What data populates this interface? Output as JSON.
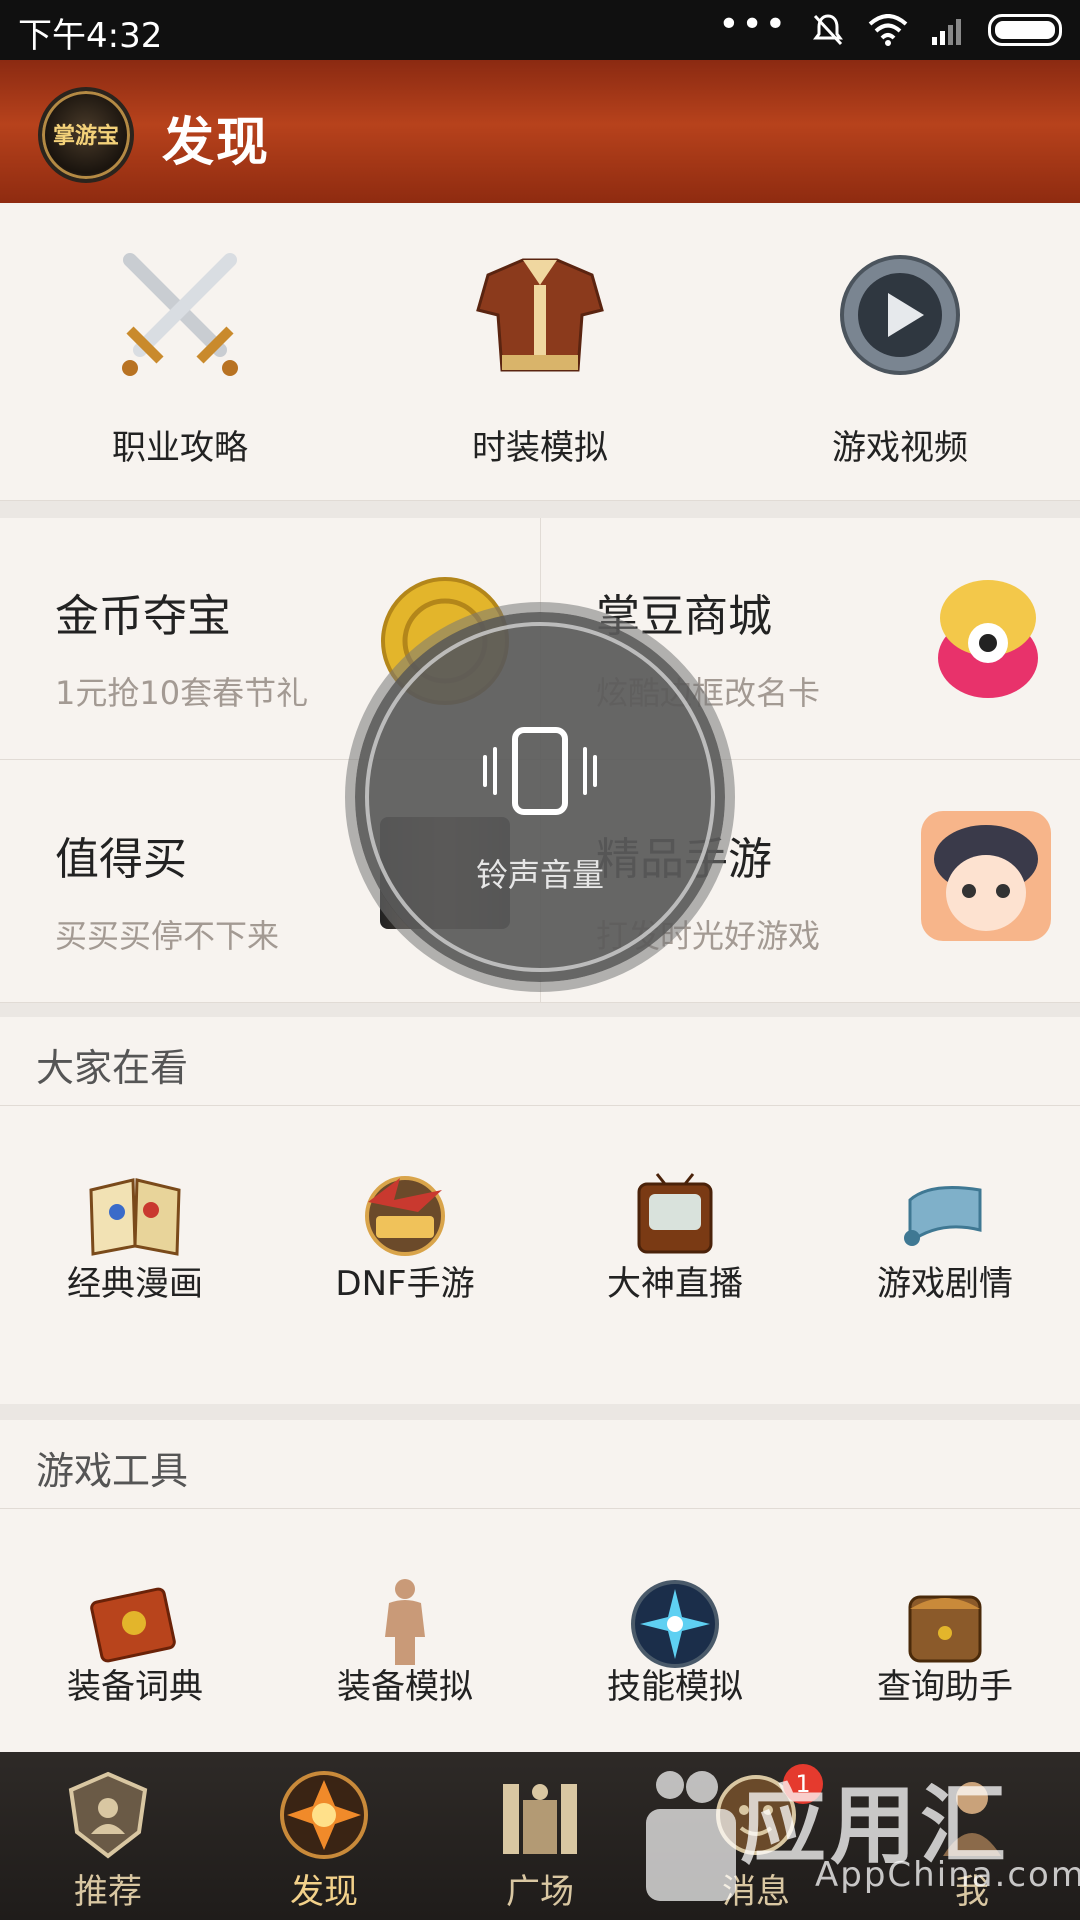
{
  "status_bar": {
    "time": "下午4:32"
  },
  "header": {
    "logo_text": "掌游宝",
    "title": "发现"
  },
  "top_tiles": [
    {
      "label": "职业攻略",
      "icon": "crossed-swords-icon"
    },
    {
      "label": "时装模拟",
      "icon": "costume-armor-icon"
    },
    {
      "label": "游戏视频",
      "icon": "video-play-icon"
    }
  ],
  "cards": [
    {
      "title": "金币夺宝",
      "subtitle": "1元抢10套春节礼"
    },
    {
      "title": "掌豆商城",
      "subtitle": "炫酷边框改名卡"
    },
    {
      "title": "值得买",
      "subtitle": "买买买停不下来"
    },
    {
      "title": "精品手游",
      "subtitle": "打发时光好游戏"
    }
  ],
  "section_watching": {
    "title": "大家在看",
    "items": [
      {
        "label": "经典漫画",
        "icon": "comic-book-icon"
      },
      {
        "label": "DNF手游",
        "icon": "dnf-mobile-icon"
      },
      {
        "label": "大神直播",
        "icon": "tv-icon"
      },
      {
        "label": "游戏剧情",
        "icon": "scroll-icon"
      }
    ]
  },
  "section_tools": {
    "title": "游戏工具",
    "items": [
      {
        "label": "装备词典",
        "icon": "dictionary-icon"
      },
      {
        "label": "装备模拟",
        "icon": "mannequin-icon"
      },
      {
        "label": "技能模拟",
        "icon": "skill-icon"
      },
      {
        "label": "查询助手",
        "icon": "backpack-icon"
      }
    ]
  },
  "nav": {
    "items": [
      {
        "label": "推荐"
      },
      {
        "label": "发现"
      },
      {
        "label": "广场"
      },
      {
        "label": "消息",
        "badge": "1"
      },
      {
        "label": "我"
      }
    ]
  },
  "volume_toast": {
    "label": "铃声音量"
  },
  "watermark": {
    "brand": "应用汇",
    "domain": "AppChina.com"
  },
  "colors": {
    "header": "#b7421c",
    "badge": "#e53a2e",
    "nav_bg": "#2e2a27"
  }
}
